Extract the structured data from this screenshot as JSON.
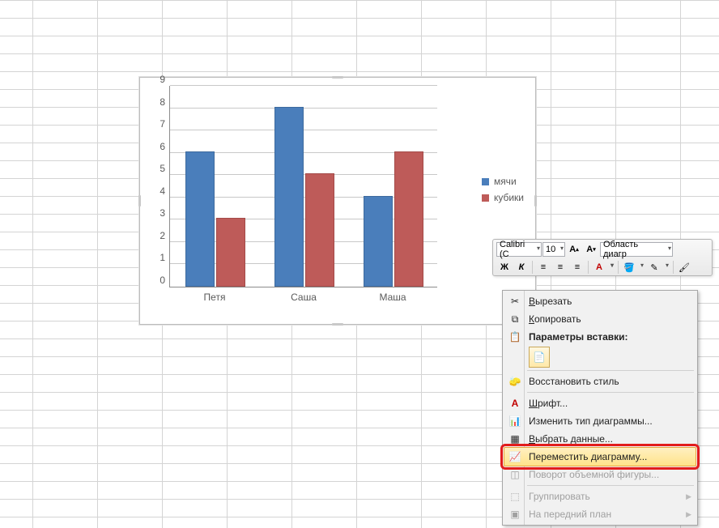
{
  "chart_data": {
    "type": "bar",
    "categories": [
      "Петя",
      "Саша",
      "Маша"
    ],
    "series": [
      {
        "name": "мячи",
        "values": [
          6,
          8,
          4
        ],
        "color": "#4a7ebb"
      },
      {
        "name": "кубики",
        "values": [
          3,
          5,
          6
        ],
        "color": "#be5b59"
      }
    ],
    "ylim": [
      0,
      9
    ],
    "ytick": 1,
    "xlabel": "",
    "ylabel": "",
    "title": "",
    "legend_position": "right"
  },
  "legend": {
    "s1": "мячи",
    "s2": "кубики"
  },
  "yticks": [
    "0",
    "1",
    "2",
    "3",
    "4",
    "5",
    "6",
    "7",
    "8",
    "9"
  ],
  "cats": {
    "c0": "Петя",
    "c1": "Саша",
    "c2": "Маша"
  },
  "mini_toolbar": {
    "font_name": "Calibri (С",
    "font_size": "10",
    "style_box": "Область диагр"
  },
  "ctx": {
    "cut": "Вырезать",
    "copy": "Копировать",
    "paste_header": "Параметры вставки:",
    "reset_style": "Восстановить стиль",
    "font": "Шрифт...",
    "change_type": "Изменить тип диаграммы...",
    "select_data": "Выбрать данные...",
    "move_chart": "Переместить диаграмму...",
    "rotate3d": "Поворот объемной фигуры...",
    "group": "Группировать",
    "bring_front": "На передний план"
  }
}
